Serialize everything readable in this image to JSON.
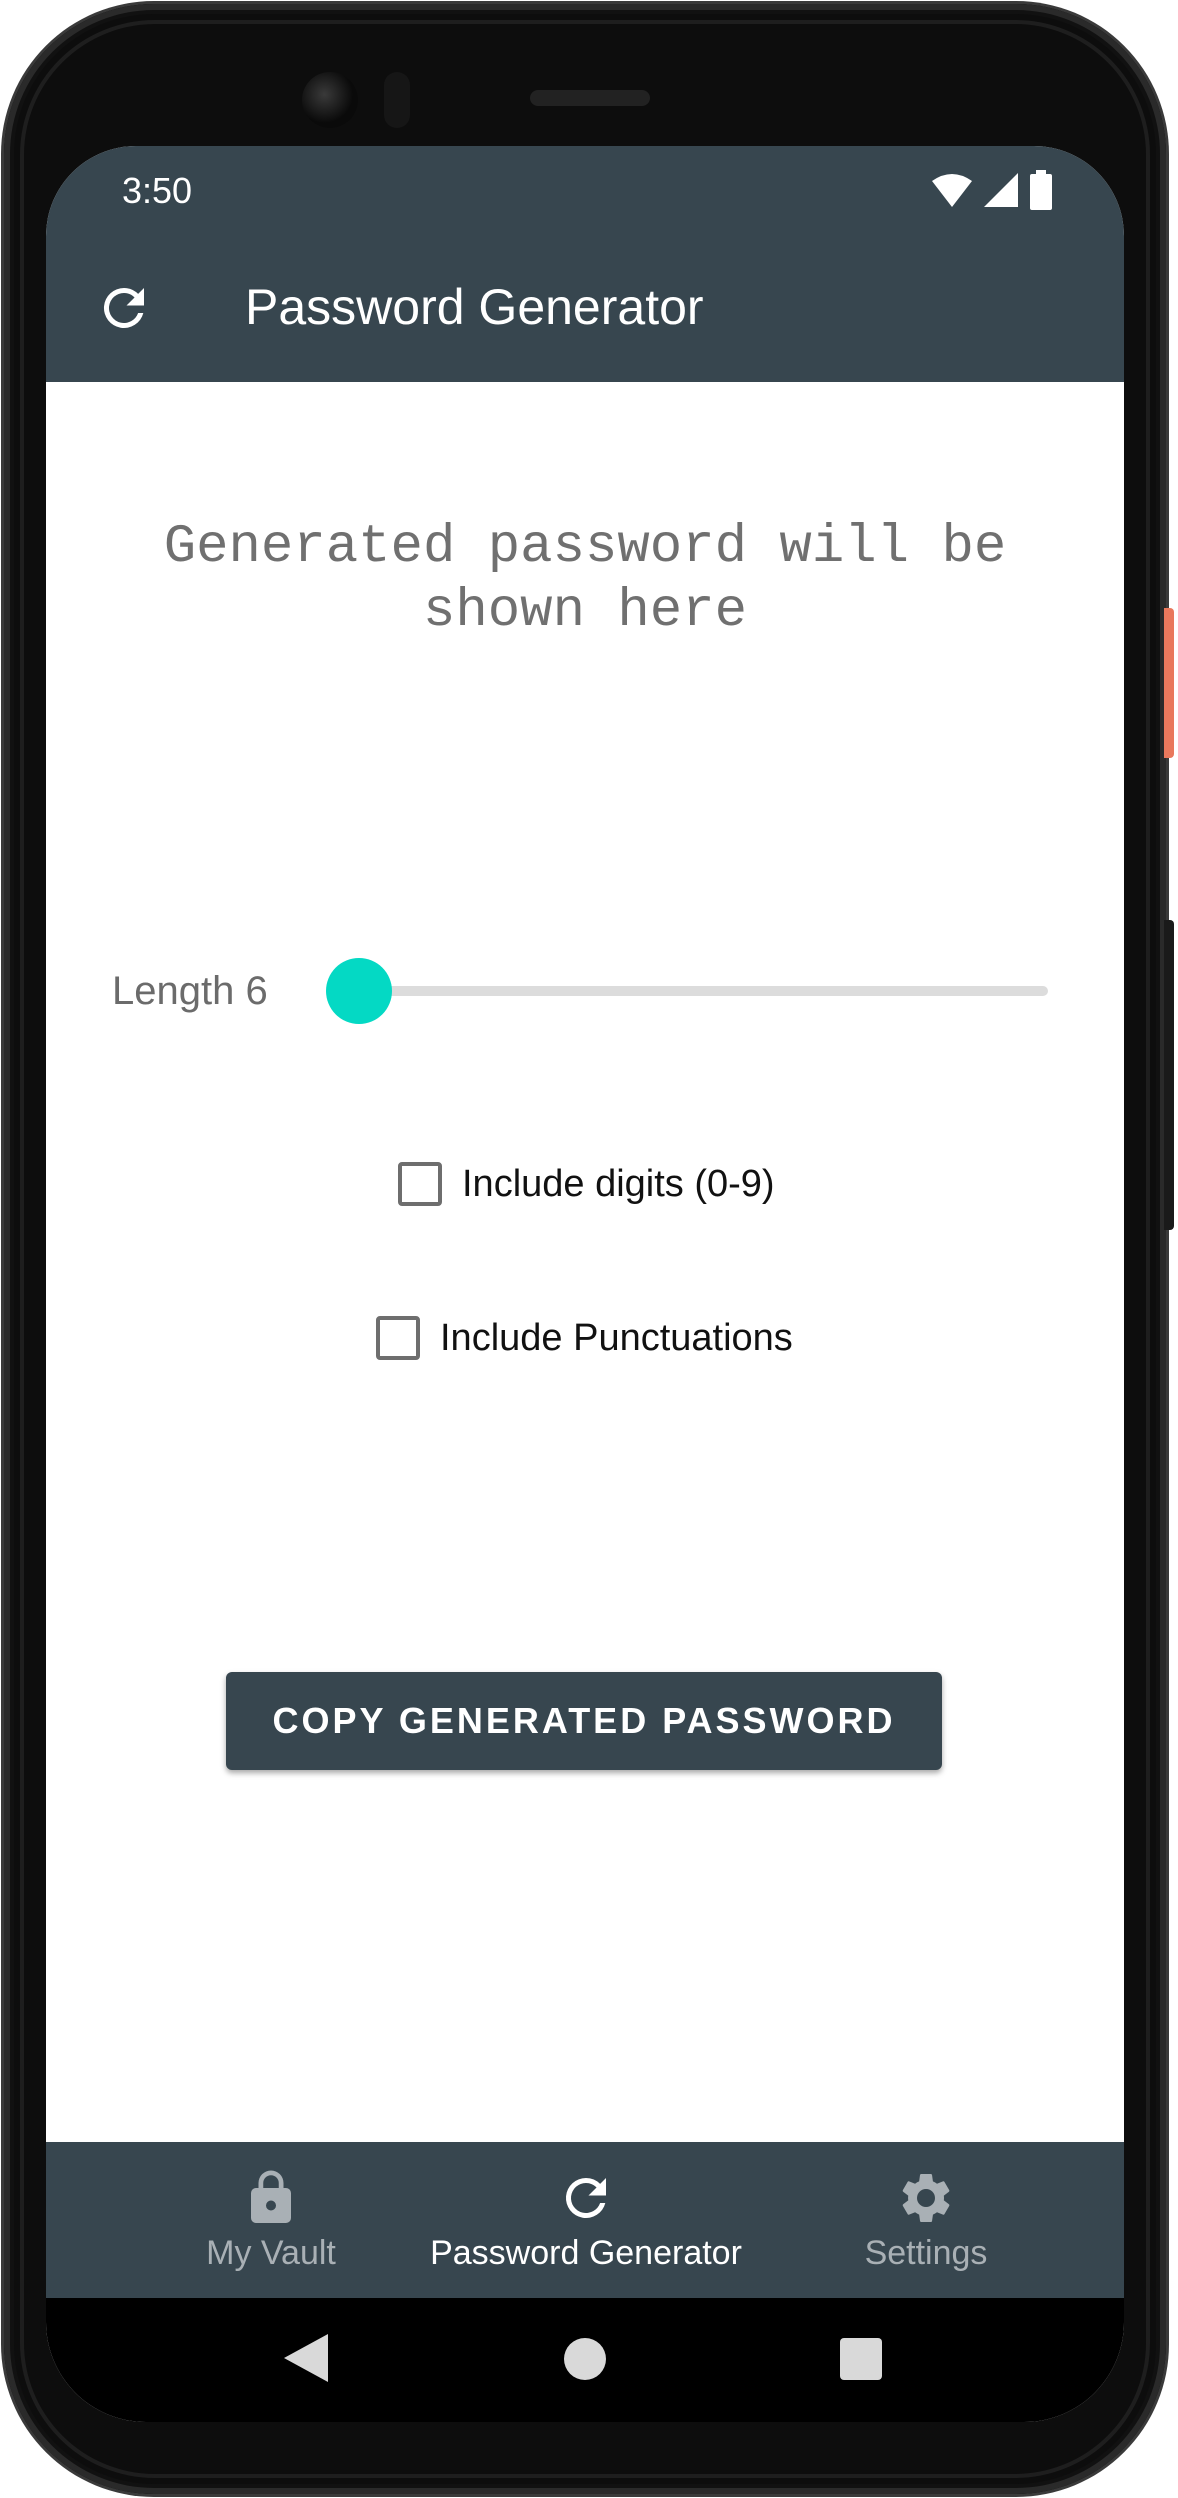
{
  "status_bar": {
    "time": "3:50"
  },
  "app_bar": {
    "title": "Password Generator",
    "refresh_icon": "refresh-icon"
  },
  "main": {
    "password_placeholder": "Generated password will be shown here",
    "length": {
      "label": "Length 6",
      "value": 6
    },
    "options": [
      {
        "label": "Include digits (0-9)",
        "checked": false
      },
      {
        "label": "Include Punctuations",
        "checked": false
      }
    ],
    "copy_button_label": "COPY GENERATED PASSWORD"
  },
  "bottom_nav": {
    "items": [
      {
        "label": "My Vault",
        "icon": "lock-icon",
        "active": false
      },
      {
        "label": "Password Generator",
        "icon": "refresh-icon",
        "active": true
      },
      {
        "label": "Settings",
        "icon": "gear-icon",
        "active": false
      }
    ]
  },
  "colors": {
    "primary": "#37464f",
    "accent": "#04d9c4"
  }
}
